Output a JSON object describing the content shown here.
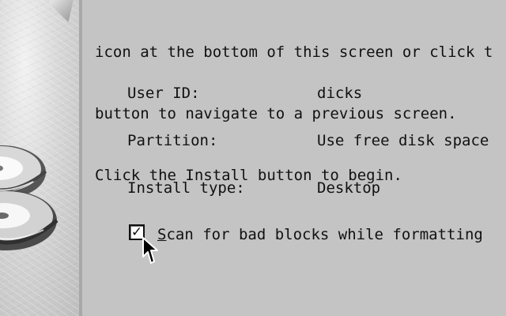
{
  "instructions": [
    "icon at the bottom of this screen or click t",
    "button to navigate to a previous screen.",
    "Click the Install button to begin."
  ],
  "summary": [
    {
      "label": "User ID:",
      "value": "dicks"
    },
    {
      "label": "Partition:",
      "value": "Use free disk space"
    },
    {
      "label": "Install type:",
      "value": "Desktop"
    }
  ],
  "scan_option": {
    "checked": true,
    "check_mark": "✓",
    "accelerator": "S",
    "label_rest": "can for bad blocks while formatting"
  },
  "colors": {
    "background": "#c4c4c4",
    "text": "#111111",
    "checkbox_fill": "#ffffff"
  },
  "icons": {
    "cursor": "arrow-pointer-icon",
    "left_art": "disc-stack-art"
  }
}
